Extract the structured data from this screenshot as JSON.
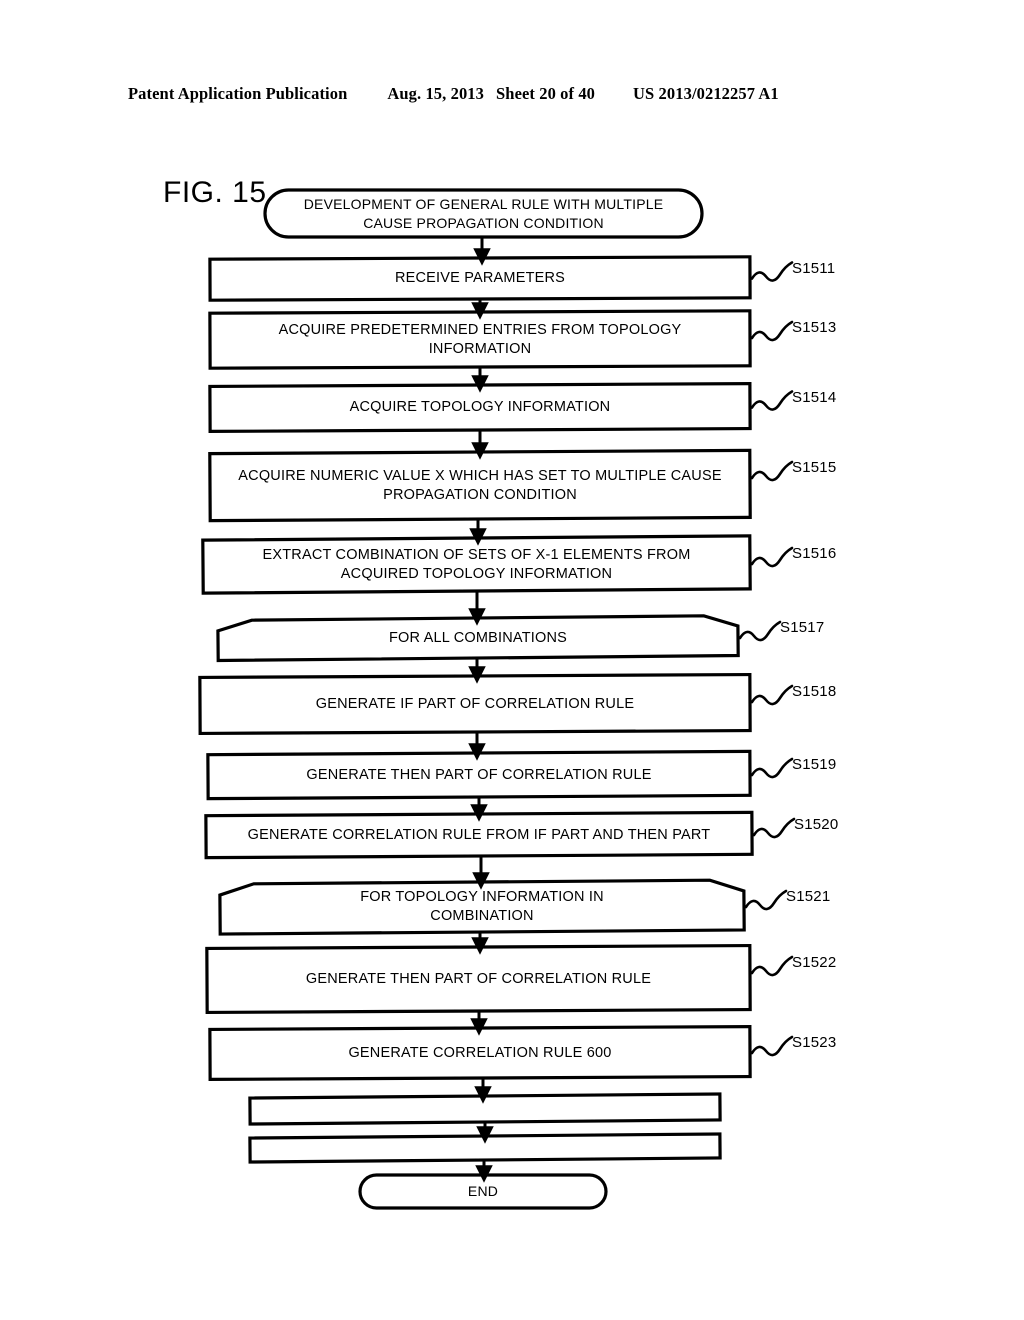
{
  "header": {
    "title": "Patent Application Publication",
    "date": "Aug. 15, 2013",
    "sheet": "Sheet 20 of 40",
    "publication_number": "US 2013/0212257 A1"
  },
  "figure": {
    "label": "FIG. 15"
  },
  "flowchart": {
    "start": {
      "shape": "terminator",
      "lines": [
        "DEVELOPMENT OF GENERAL RULE WITH MULTIPLE",
        "CAUSE PROPAGATION CONDITION"
      ]
    },
    "end": {
      "shape": "terminator",
      "lines": [
        "END"
      ]
    },
    "steps": [
      {
        "id": "S1511",
        "shape": "process",
        "lines": [
          "RECEIVE PARAMETERS"
        ]
      },
      {
        "id": "S1513",
        "shape": "process",
        "lines": [
          "ACQUIRE PREDETERMINED ENTRIES FROM TOPOLOGY",
          "INFORMATION"
        ]
      },
      {
        "id": "S1514",
        "shape": "process",
        "lines": [
          "ACQUIRE TOPOLOGY INFORMATION"
        ]
      },
      {
        "id": "S1515",
        "shape": "process",
        "lines": [
          "ACQUIRE NUMERIC VALUE X WHICH HAS SET TO MULTIPLE CAUSE",
          "PROPAGATION CONDITION"
        ]
      },
      {
        "id": "S1516",
        "shape": "process",
        "lines": [
          "EXTRACT COMBINATION OF SETS OF X-1 ELEMENTS FROM",
          "ACQUIRED TOPOLOGY INFORMATION"
        ]
      },
      {
        "id": "S1517",
        "shape": "loop-start",
        "lines": [
          "FOR ALL COMBINATIONS"
        ]
      },
      {
        "id": "S1518",
        "shape": "process",
        "lines": [
          "GENERATE IF PART OF CORRELATION RULE"
        ]
      },
      {
        "id": "S1519",
        "shape": "process",
        "lines": [
          "GENERATE THEN PART OF CORRELATION RULE"
        ]
      },
      {
        "id": "S1520",
        "shape": "process",
        "lines": [
          "GENERATE CORRELATION RULE FROM IF PART AND THEN PART"
        ]
      },
      {
        "id": "S1521",
        "shape": "loop-start",
        "lines": [
          "FOR TOPOLOGY INFORMATION IN",
          "COMBINATION"
        ]
      },
      {
        "id": "S1522",
        "shape": "process",
        "lines": [
          "GENERATE THEN PART OF CORRELATION RULE"
        ]
      },
      {
        "id": "S1523",
        "shape": "process",
        "lines": [
          "GENERATE CORRELATION RULE 600"
        ]
      },
      {
        "id": "",
        "shape": "loop-end",
        "lines": [
          ""
        ]
      },
      {
        "id": "",
        "shape": "loop-end",
        "lines": [
          ""
        ]
      }
    ]
  },
  "colors": {
    "ink": "#000000",
    "paper": "#ffffff"
  }
}
